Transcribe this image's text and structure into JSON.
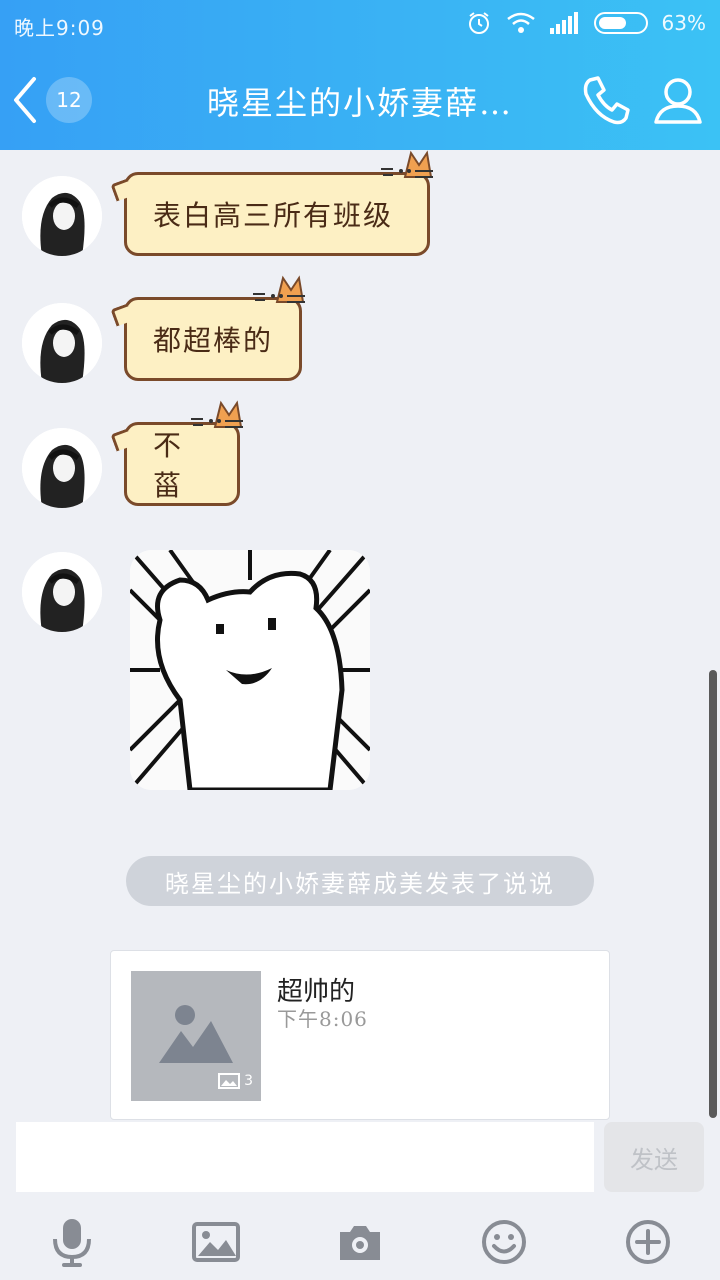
{
  "status_bar": {
    "time": "晚上9:09",
    "battery": "63%",
    "battery_level": 0.63
  },
  "nav": {
    "unread_count": "12",
    "title": "晓星尘的小娇妻薛…"
  },
  "messages": [
    {
      "text": "表白高三所有班级"
    },
    {
      "text": "都超棒的"
    },
    {
      "text": "不菑"
    }
  ],
  "system_notice": "晓星尘的小娇妻薛成美发表了说说",
  "post": {
    "title": "超帅的",
    "time": "下午8:06",
    "image_count": "3"
  },
  "input": {
    "value": "",
    "send_label": "发送"
  },
  "colors": {
    "header": "#3aaaf5",
    "bubble_fill": "#fdf0c4",
    "bubble_border": "#7a4a2a",
    "background": "#eef0f5"
  },
  "icons": [
    "back-arrow-icon",
    "phone-icon",
    "person-icon",
    "mic-icon",
    "image-icon",
    "camera-icon",
    "emoji-icon",
    "plus-icon"
  ]
}
